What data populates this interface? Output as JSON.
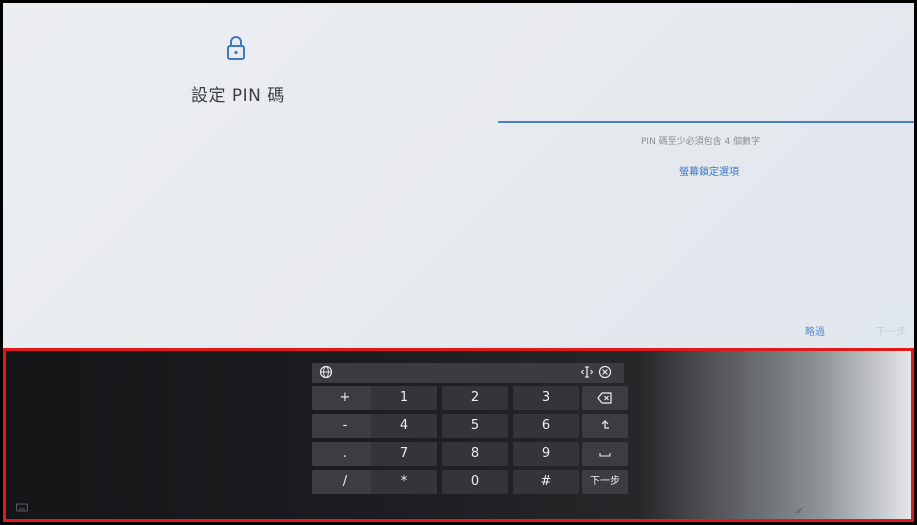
{
  "setup": {
    "title": "設定 PIN 碼",
    "hint": "PIN 碼至少必須包含 4 個數字",
    "screen_lock_link": "螢幕鎖定選項",
    "skip_label": "略過",
    "next_label": "下一步",
    "icon": "lock-icon"
  },
  "keyboard": {
    "rows": [
      [
        "+",
        "1",
        "2",
        "3",
        "backspace"
      ],
      [
        "-",
        "4",
        "5",
        "6",
        "return"
      ],
      [
        ".",
        "7",
        "8",
        "9",
        "space"
      ],
      [
        "/",
        "*",
        "0",
        "#",
        "下一步"
      ]
    ],
    "keys": {
      "plus": "+",
      "one": "1",
      "two": "2",
      "three": "3",
      "minus": "-",
      "four": "4",
      "five": "5",
      "six": "6",
      "period": ".",
      "seven": "7",
      "eight": "8",
      "nine": "9",
      "slash": "/",
      "star": "*",
      "zero": "0",
      "hash": "#",
      "next": "下一步"
    },
    "icons": [
      "globe-icon",
      "cursor-move-icon",
      "close-circle-icon",
      "backspace-icon",
      "return-icon",
      "space-icon",
      "keyboard-icon",
      "collapse-icon"
    ]
  },
  "colors": {
    "accent": "#3f77c4",
    "highlight_border": "#e0191d",
    "keyboard_key": "#343538"
  }
}
